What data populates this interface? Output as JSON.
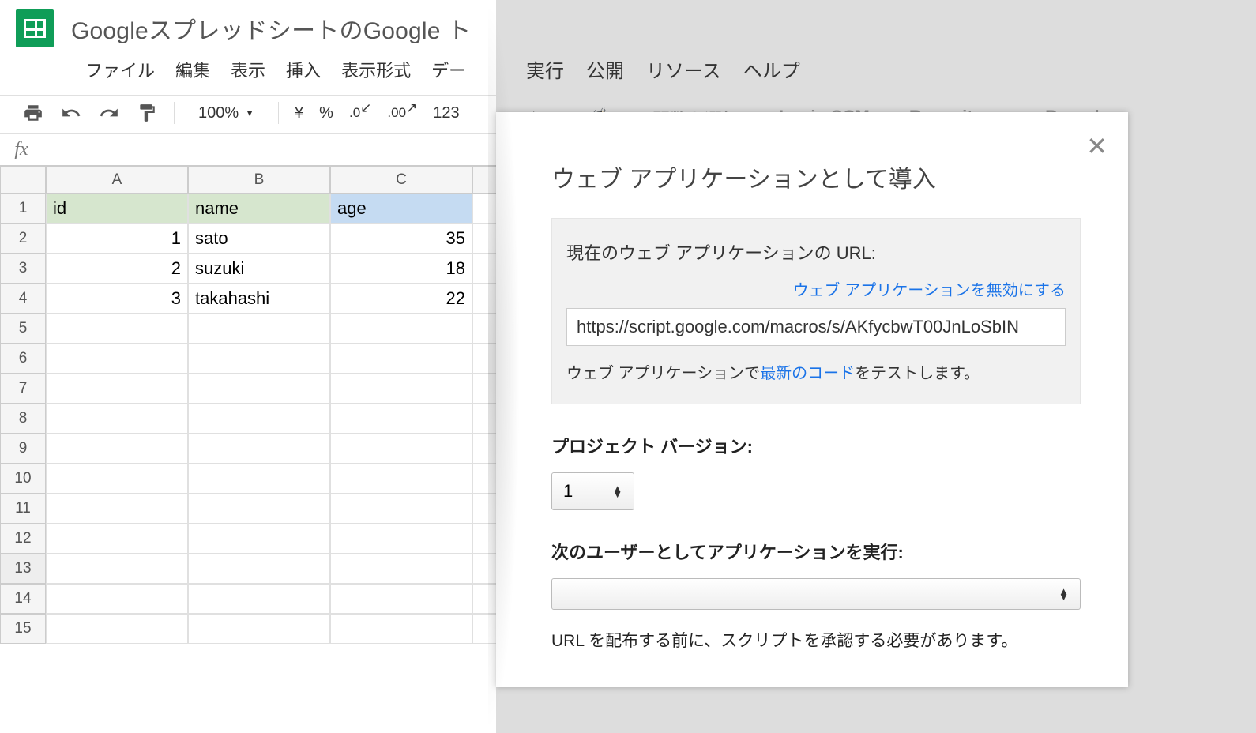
{
  "sheets": {
    "doc_title": "GoogleスプレッドシートのGoogle ト",
    "menu": [
      "ファイル",
      "編集",
      "表示",
      "挿入",
      "表示形式",
      "デー"
    ],
    "zoom": "100%",
    "currency": "¥",
    "percent": "%",
    "dec_dec": ".0",
    "dec_inc": ".00",
    "num_fmt": "123",
    "fx": "",
    "columns": [
      "A",
      "B",
      "C"
    ],
    "rows": [
      "1",
      "2",
      "3",
      "4",
      "5",
      "6",
      "7",
      "8",
      "9",
      "10",
      "11",
      "12",
      "13",
      "14",
      "15"
    ],
    "headers": [
      "id",
      "name",
      "age"
    ],
    "data": [
      {
        "id": 1,
        "name": "sato",
        "age": 35
      },
      {
        "id": 2,
        "name": "suzuki",
        "age": 18
      },
      {
        "id": 3,
        "name": "takahashi",
        "age": 22
      }
    ],
    "selected_row": "13"
  },
  "script": {
    "menu": [
      "実行",
      "公開",
      "リソース",
      "ヘルプ"
    ],
    "toolbar": [
      "関数を選択",
      "Login SCM",
      "Repository:",
      "Branch"
    ]
  },
  "dialog": {
    "title": "ウェブ アプリケーションとして導入",
    "url_label": "現在のウェブ アプリケーションの URL:",
    "disable_link": "ウェブ アプリケーションを無効にする",
    "url_value": "https://script.google.com/macros/s/AKfycbwT00JnLoSbIN",
    "test_before": "ウェブ アプリケーションで",
    "test_link": "最新のコード",
    "test_after": "をテストします。",
    "version_label": "プロジェクト バージョン:",
    "version_value": "1",
    "runas_label": "次のユーザーとしてアプリケーションを実行:",
    "note": "URL を配布する前に、スクリプトを承認する必要があります。"
  }
}
